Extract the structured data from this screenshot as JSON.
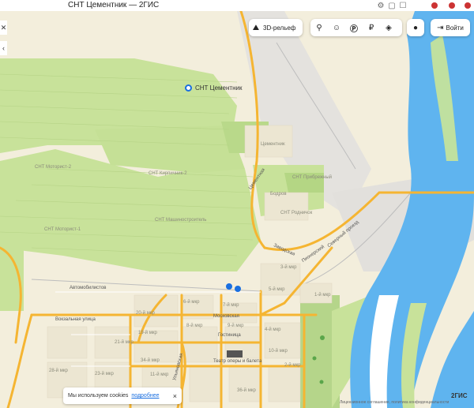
{
  "window": {
    "title": "СНТ Цементник — 2ГИС"
  },
  "controls": {
    "relief_label": "3D-рельеф",
    "login_label": "Войти"
  },
  "poi": {
    "label": "СНТ Цементник"
  },
  "map_labels": {
    "snt_tsementnik_small": "Цементник",
    "snt_motorist": "СНТ Моторист-2",
    "snt_kirpichnik": "СНТ Кирпичник-2",
    "snt_motorist1": "СНТ Моторист-1",
    "snt_mashinostroitel": "СНТ Машиностроитель",
    "snt_rodnichok": "СНТ Родничок",
    "snt_pribrezhny": "СНТ Прибрежный",
    "bodrov": "Бодров",
    "street_tsementnaya": "Цементная",
    "street_zavodskaya": "Заводская",
    "street_avtomobilistov": "Автомобилистов",
    "street_vokzalnaya": "Вокзальная улица",
    "street_moskovskaya": "Московская",
    "street_pionerskaya": "Пионерский",
    "street_severny": "Северный проезд",
    "street_ulyanovskaya": "Ульяновская",
    "place_gostinitsa": "Гостиница",
    "place_teatr": "Театр оперы и балета",
    "mkr_5": "5-й мкр",
    "mkr_6": "6-й мкр",
    "mkr_7": "7-й мкр",
    "mkr_3": "3-й мкр",
    "mkr_9": "9-й мкр",
    "mkr_8": "8-й мкр",
    "mkr_20": "20-й мкр",
    "mkr_19": "19-й мкр",
    "mkr_4": "4-й мкр",
    "mkr_10": "10-й мкр",
    "mkr_1": "1-й мкр",
    "mkr_21": "21-й мкр",
    "mkr_2": "2-й мкр",
    "mkr_23": "23-й мкр",
    "mkr_34": "34-й мкр",
    "mkr_36": "36-й мкр",
    "mkr_28": "28-й мкр",
    "mkr_11": "11-й мкр"
  },
  "cookie": {
    "text": "Мы используем cookies",
    "link": "подробнее",
    "close": "×"
  },
  "brand": "2ГИС",
  "legal": "Лицензионное соглашение, политика конфиденциальности",
  "colors": {
    "road": "#f5b532",
    "park": "#c8e29a",
    "water": "#5fb4ef",
    "accent": "#1a6fe0"
  }
}
